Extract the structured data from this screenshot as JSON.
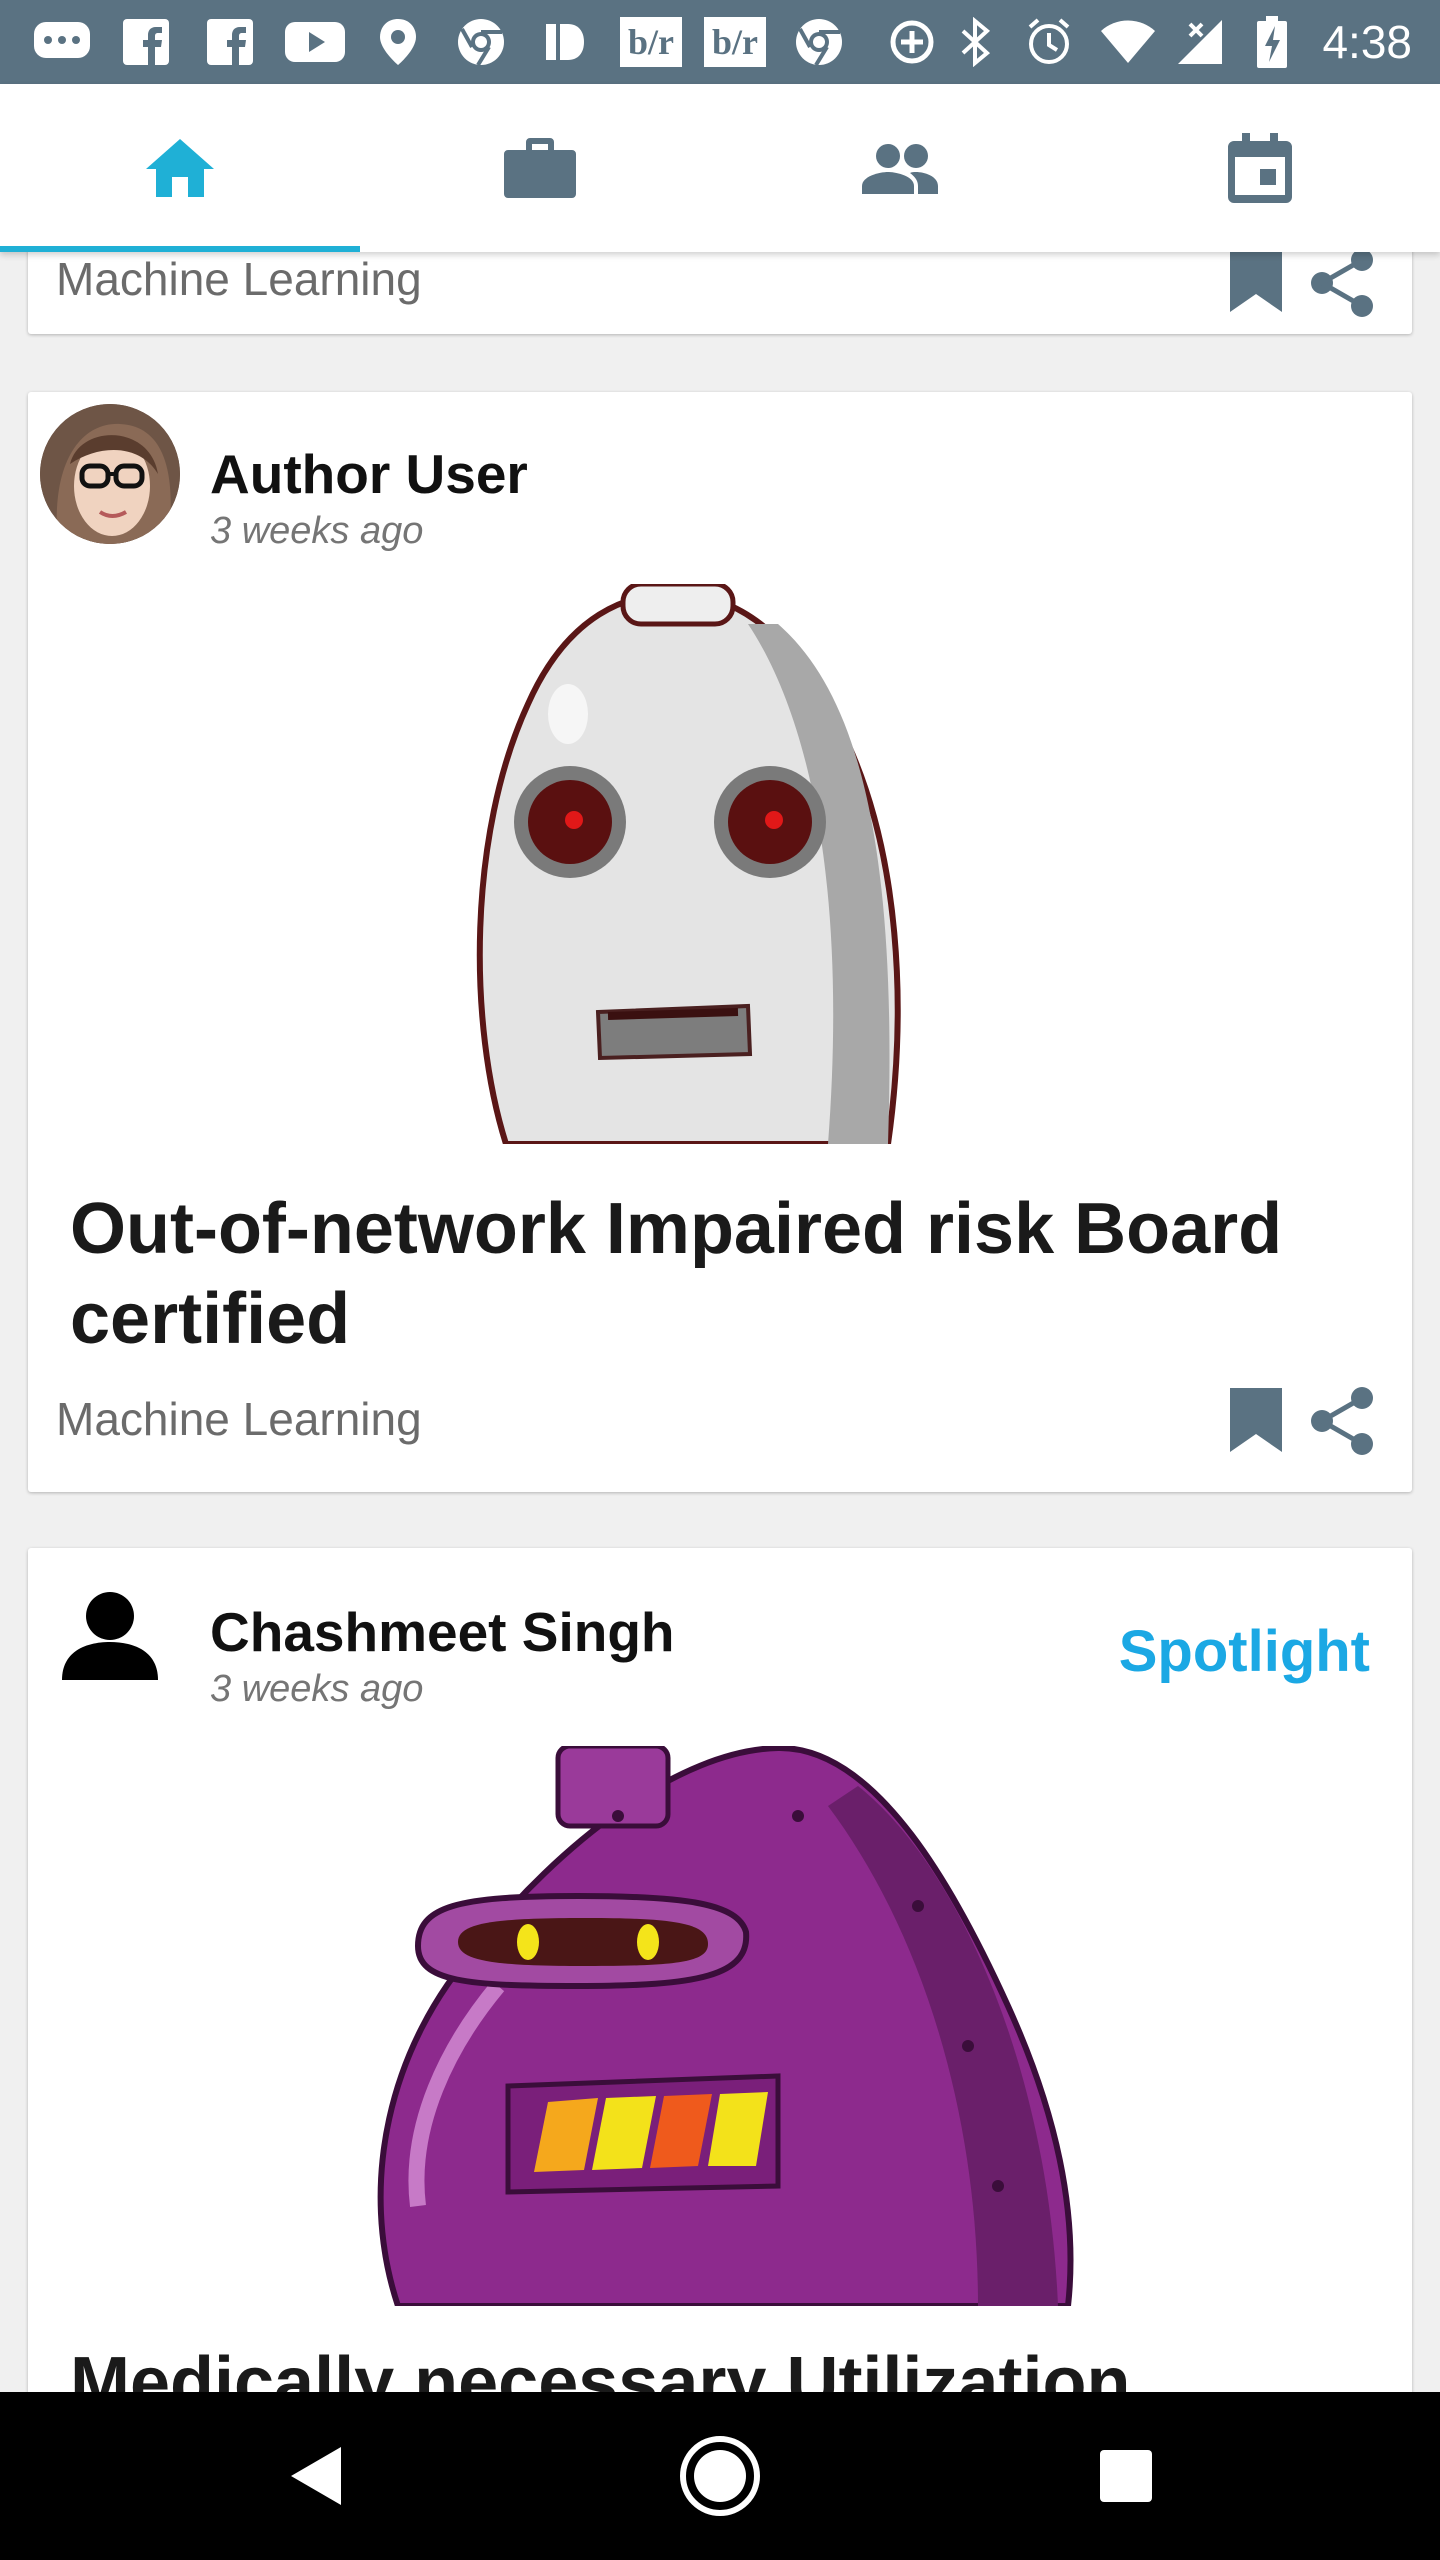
{
  "status_bar": {
    "time": "4:38",
    "icons": [
      "messages-icon",
      "facebook-icon",
      "facebook-icon",
      "youtube-icon",
      "location-pin-icon",
      "chrome-icon",
      "pandora-icon",
      "bleacher-report-icon",
      "bleacher-report-icon",
      "chrome-icon",
      "data-saver-icon",
      "bluetooth-icon",
      "alarm-icon",
      "wifi-icon",
      "cell-signal-icon",
      "battery-charging-icon"
    ],
    "brand_text": "b/r"
  },
  "tabs": [
    {
      "name": "home",
      "icon": "home-icon",
      "active": true
    },
    {
      "name": "jobs",
      "icon": "briefcase-icon",
      "active": false
    },
    {
      "name": "people",
      "icon": "people-icon",
      "active": false
    },
    {
      "name": "events",
      "icon": "calendar-icon",
      "active": false
    }
  ],
  "colors": {
    "accent": "#1fb0d6",
    "spotlight": "#1ba8e4",
    "status_bar": "#5a7282",
    "inactive_icon": "#5a7282"
  },
  "feed": {
    "partial_card": {
      "category": "Machine Learning"
    },
    "post1": {
      "author": "Author User",
      "time_ago": "3 weeks ago",
      "title": "Out-of-network Impaired risk Board certified",
      "category": "Machine Learning"
    },
    "post2": {
      "author": "Chashmeet Singh",
      "time_ago": "3 weeks ago",
      "badge": "Spotlight",
      "title": "Medically necessary Utilization"
    }
  },
  "nav_bar": {
    "icons": [
      "back-icon",
      "home-circle-icon",
      "recents-icon"
    ]
  }
}
